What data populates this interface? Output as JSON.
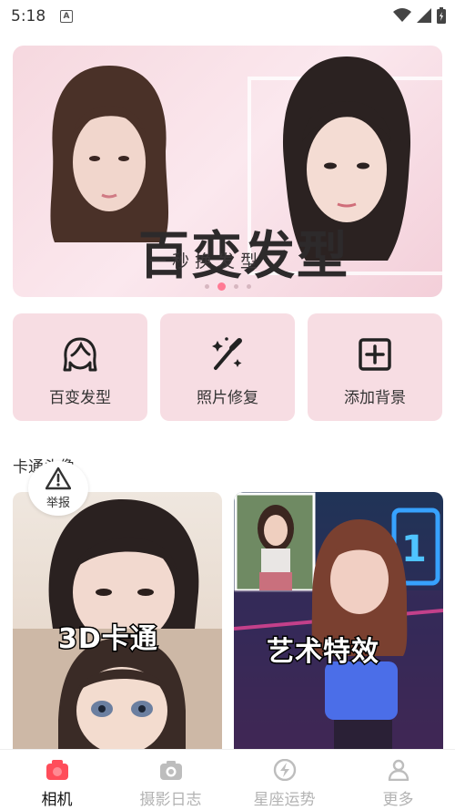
{
  "status_bar": {
    "time": "5:18",
    "notification": "A"
  },
  "banner": {
    "title": "百变发型",
    "subtitle": "一秒换发型",
    "page_count": 4,
    "active_page": 2
  },
  "features": [
    {
      "label": "百变发型",
      "icon": "hair-face-icon"
    },
    {
      "label": "照片修复",
      "icon": "magic-wand-icon"
    },
    {
      "label": "添加背景",
      "icon": "add-square-icon"
    }
  ],
  "section": {
    "title": "卡通头像"
  },
  "report": {
    "label": "举报"
  },
  "cards": [
    {
      "label": "3D卡通"
    },
    {
      "label": "艺术特效"
    }
  ],
  "nav": [
    {
      "label": "相机",
      "icon": "camera-icon",
      "active": true
    },
    {
      "label": "摄影日志",
      "icon": "photo-camera-icon",
      "active": false
    },
    {
      "label": "星座运势",
      "icon": "lightning-icon",
      "active": false
    },
    {
      "label": "更多",
      "icon": "person-icon",
      "active": false
    }
  ],
  "colors": {
    "accent": "#ff4d5a",
    "card_bg": "#f7dde3",
    "inactive": "#b3b3b3"
  }
}
